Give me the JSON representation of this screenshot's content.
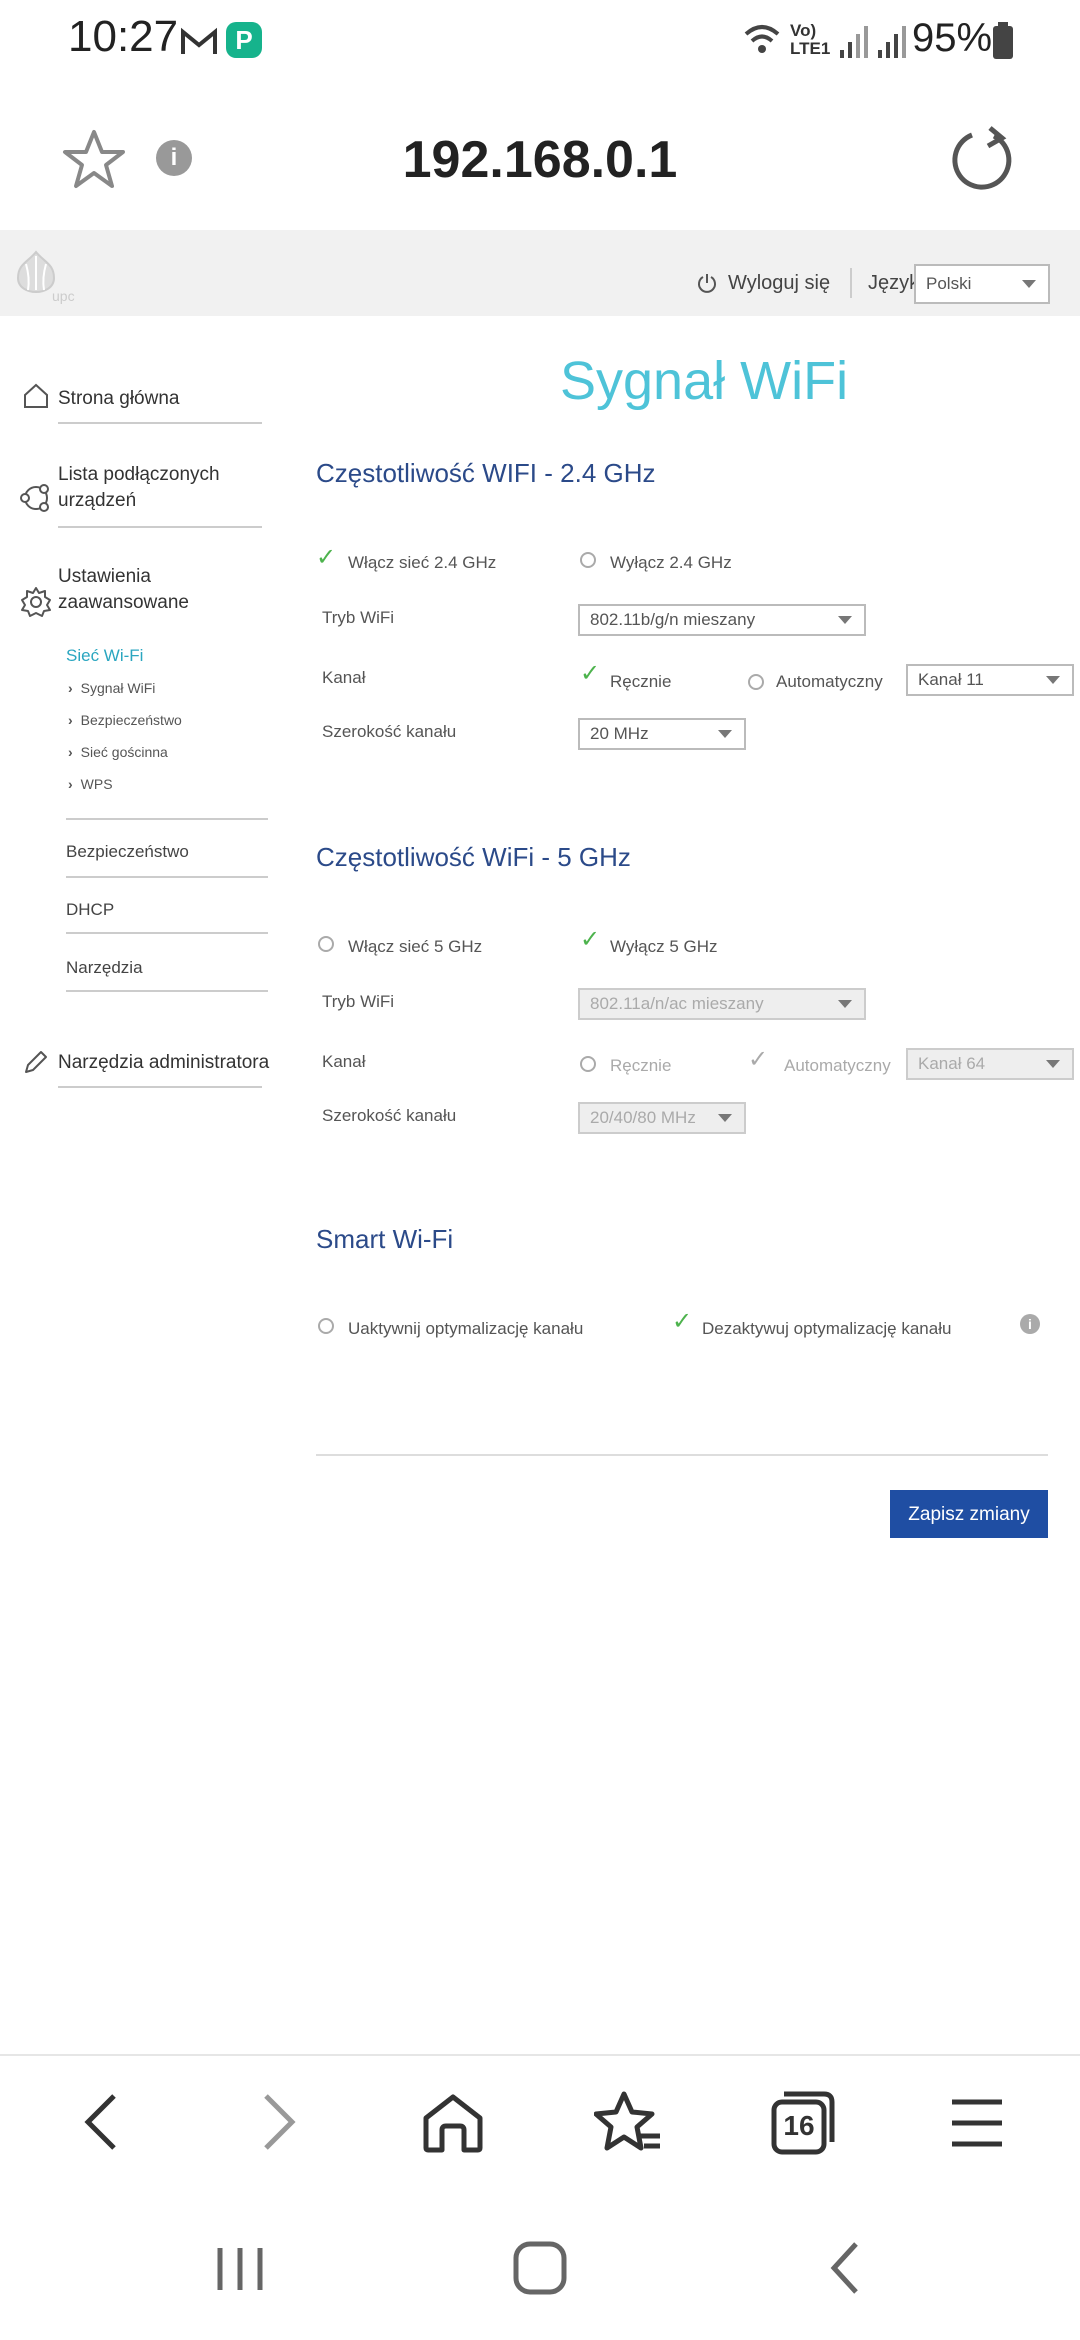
{
  "status_bar": {
    "time": "10:27",
    "network": "Vo) LTE1",
    "battery": "95%"
  },
  "browser": {
    "url": "192.168.0.1",
    "tab_count": "16"
  },
  "router_header": {
    "logo": "upc",
    "logout_label": "Wyloguj się",
    "language_label": "Język",
    "language_value": "Polski"
  },
  "sidebar": {
    "home": "Strona główna",
    "devices_line1": "Lista podłączonych",
    "devices_line2": "urządzeń",
    "advanced_line1": "Ustawienia",
    "advanced_line2": "zaawansowane",
    "wifi_network": "Sieć Wi-Fi",
    "sub_items": [
      "Sygnał WiFi",
      "Bezpieczeństwo",
      "Sieć gościnna",
      "WPS"
    ],
    "security": "Bezpieczeństwo",
    "dhcp": "DHCP",
    "tools": "Narzędzia",
    "admin_tools": "Narzędzia administratora"
  },
  "page": {
    "title": "Sygnał WiFi",
    "band24": {
      "title": "Częstotliwość WIFI - 2.4 GHz",
      "enable_label": "Włącz sieć 2.4 GHz",
      "disable_label": "Wyłącz 2.4 GHz",
      "mode_label": "Tryb WiFi",
      "mode_value": "802.11b/g/n mieszany",
      "channel_label": "Kanał",
      "manual_label": "Ręcznie",
      "auto_label": "Automatyczny",
      "channel_value": "Kanał 11",
      "width_label": "Szerokość kanału",
      "width_value": "20 MHz"
    },
    "band5": {
      "title": "Częstotliwość WiFi - 5 GHz",
      "enable_label": "Włącz sieć 5 GHz",
      "disable_label": "Wyłącz 5 GHz",
      "mode_label": "Tryb WiFi",
      "mode_value": "802.11a/n/ac mieszany",
      "channel_label": "Kanał",
      "manual_label": "Ręcznie",
      "auto_label": "Automatyczny",
      "channel_value": "Kanał 64",
      "width_label": "Szerokość kanału",
      "width_value": "20/40/80 MHz"
    },
    "smart": {
      "title": "Smart Wi-Fi",
      "activate_label": "Uaktywnij optymalizację kanału",
      "deactivate_label": "Dezaktywuj optymalizację kanału"
    },
    "save_label": "Zapisz zmiany"
  },
  "colors": {
    "accent": "#4ec3d8",
    "section_title": "#2b4a89",
    "button": "#1f4ea3",
    "check": "#4db34d"
  }
}
